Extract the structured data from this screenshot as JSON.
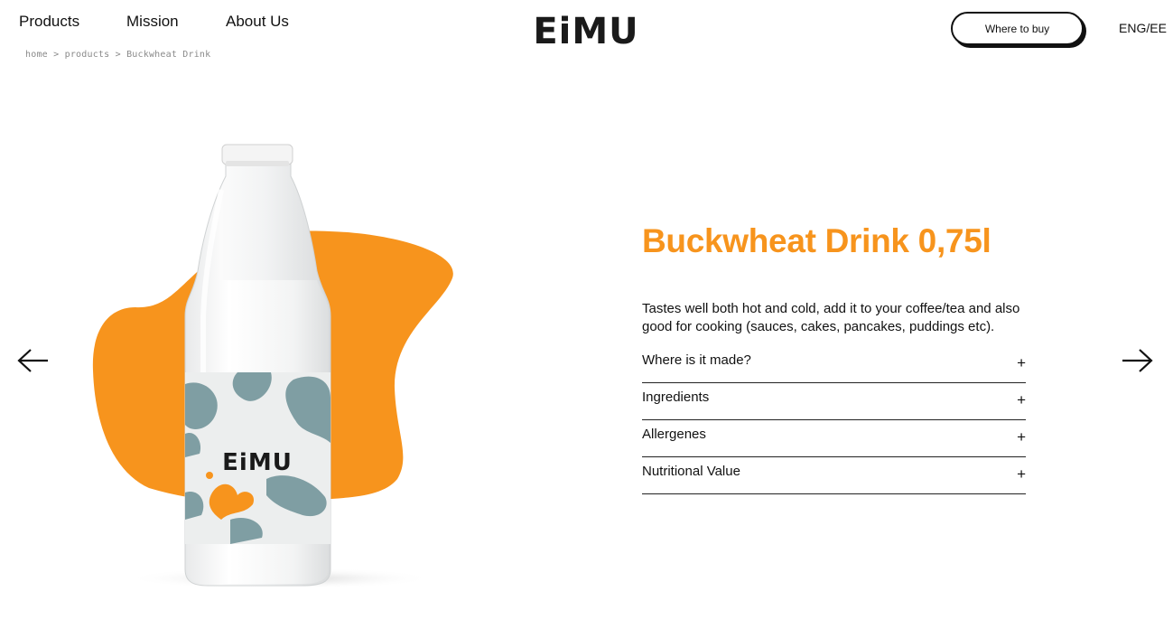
{
  "nav": {
    "items": [
      "Products",
      "Mission",
      "About Us"
    ]
  },
  "breadcrumb": {
    "home": "home",
    "sep": ">",
    "products": "products",
    "current": "Buckwheat Drink"
  },
  "brand": {
    "logo_text": "EiMU",
    "accent": "#f7941d",
    "label_color": "#7f9ea3"
  },
  "header": {
    "buy_label": "Where to buy",
    "lang": "ENG/EE"
  },
  "product": {
    "title": "Buckwheat Drink 0,75l",
    "description": "Tastes well both hot and cold, add it to your coffee/tea and also good for cooking (sauces, cakes, pancakes, puddings etc).",
    "accordion": [
      "Where is it made?",
      "Ingredients",
      "Allergenes",
      "Nutritional Value"
    ],
    "expand_symbol": "+"
  },
  "icons": {
    "prev": "arrow-left-icon",
    "next": "arrow-right-icon"
  }
}
